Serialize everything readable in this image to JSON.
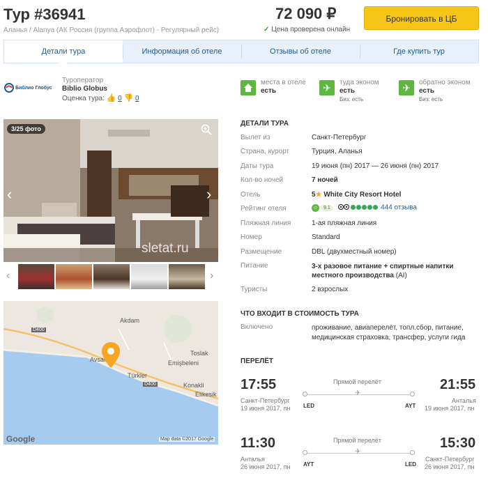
{
  "header": {
    "title": "Тур #36941",
    "subtitle": "Аланья / Alanya (АК Россия (группа Аэрофлот) - Регулярный рейс)",
    "price": "72 090 ₽",
    "price_checked": "Цена проверена онлайн",
    "book_button": "Бронировать в ЦБ"
  },
  "tabs": [
    {
      "label": "Детали тура",
      "active": true
    },
    {
      "label": "Информация об отеле"
    },
    {
      "label": "Отзывы об отеле"
    },
    {
      "label": "Где купить тур"
    }
  ],
  "operator": {
    "logo_text": "Библио Глобус",
    "label": "Туроператор",
    "name": "Biblio Globus",
    "rating_label": "Оценка тура:",
    "likes": "0",
    "dislikes": "0"
  },
  "availability": [
    {
      "icon": "home-icon",
      "line1": "места в отеле",
      "line2": "есть",
      "line3": ""
    },
    {
      "icon": "plane-icon",
      "line1": "туда эконом",
      "line2": "есть",
      "line3": "Биз: есть"
    },
    {
      "icon": "plane-icon",
      "line1": "обратно эконом",
      "line2": "есть",
      "line3": "Биз: есть"
    }
  ],
  "gallery": {
    "counter": "3/25 фото",
    "watermark": "sletat.ru"
  },
  "map": {
    "labels": [
      "Akdam",
      "Avsallar",
      "Toslak",
      "Emişbeleni",
      "Türkler",
      "Konakli",
      "Elikesik"
    ],
    "roads": [
      "D400",
      "D400"
    ],
    "google": "Google",
    "copyright": "Map data ©2017 Google"
  },
  "details": {
    "section_title": "ДЕТАЛИ ТУРА",
    "rows": [
      {
        "label": "Вылет из",
        "value": "Санкт-Петербург"
      },
      {
        "label": "Страна, курорт",
        "value": "Турция, Аланья"
      },
      {
        "label": "Даты тура",
        "value": "19 июня (пн) 2017 — 26 июня (пн) 2017"
      },
      {
        "label": "Кол-во ночей",
        "value": "7 ночей"
      },
      {
        "label": "Отель",
        "stars": "5",
        "value": "White City Resort Hotel"
      },
      {
        "label": "Рейтинг отеля",
        "rating": "9.1",
        "reviews": "444 отзыва"
      },
      {
        "label": "Пляжная линия",
        "value": "1-ая пляжная линия"
      },
      {
        "label": "Номер",
        "value": "Standard"
      },
      {
        "label": "Размещение",
        "value": "DBL (двухместный номер)"
      },
      {
        "label": "Питание",
        "value_bold": "3-х разовое питание + спиртные напитки местного производства",
        "value_suffix": " (AI)"
      },
      {
        "label": "Туристы",
        "value": "2 взрослых"
      }
    ]
  },
  "included": {
    "section_title": "ЧТО ВХОДИТ В СТОИМОСТЬ ТУРА",
    "label": "Включено",
    "value": "проживание, авиаперелёт, топл.сбор, питание, медицинская страховка, трансфер, услуги гида"
  },
  "flights": {
    "section_title": "ПЕРЕЛЁТ",
    "items": [
      {
        "dep_time": "17:55",
        "dep_city": "Санкт-Петербург",
        "dep_date": "19 июня 2017, пн",
        "dep_code": "LED",
        "arr_time": "21:55",
        "arr_city": "Анталья",
        "arr_date": "19 июня 2017, пн",
        "arr_code": "AYT",
        "type": "Прямой перелёт"
      },
      {
        "dep_time": "11:30",
        "dep_city": "Анталья",
        "dep_date": "26 июня 2017, пн",
        "dep_code": "AYT",
        "arr_time": "15:30",
        "arr_city": "Санкт-Петербург",
        "arr_date": "26 июня 2017, пн",
        "arr_code": "LED",
        "type": "Прямой перелёт"
      }
    ]
  }
}
